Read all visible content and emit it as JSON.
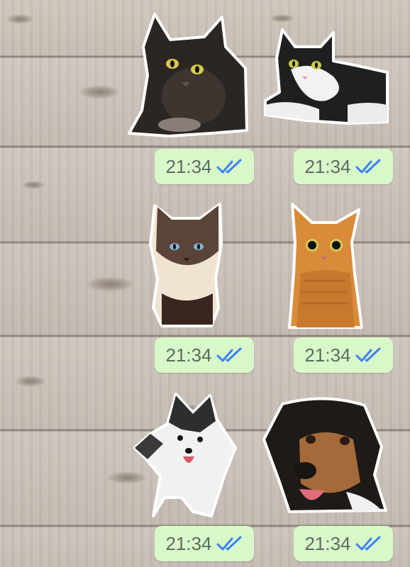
{
  "messages": [
    {
      "sticker_icon": "black-longhair-cat-sticker-icon",
      "time": "21:34",
      "status_icon": "double-check-read-icon"
    },
    {
      "sticker_icon": "black-white-cat-sticker-icon",
      "time": "21:34",
      "status_icon": "double-check-read-icon"
    },
    {
      "sticker_icon": "siamese-cat-sticker-icon",
      "time": "21:34",
      "status_icon": "double-check-read-icon"
    },
    {
      "sticker_icon": "orange-tabby-cat-sticker-icon",
      "time": "21:34",
      "status_icon": "double-check-read-icon"
    },
    {
      "sticker_icon": "chihuahua-dog-sticker-icon",
      "time": "21:34",
      "status_icon": "double-check-read-icon"
    },
    {
      "sticker_icon": "hound-dog-sticker-icon",
      "time": "21:34",
      "status_icon": "double-check-read-icon"
    }
  ],
  "colors": {
    "bubble": "#d9f8c9",
    "time_text": "#5d6b63",
    "read_ticks": "#3b82f6",
    "background_wood": "#c9c0b8"
  }
}
